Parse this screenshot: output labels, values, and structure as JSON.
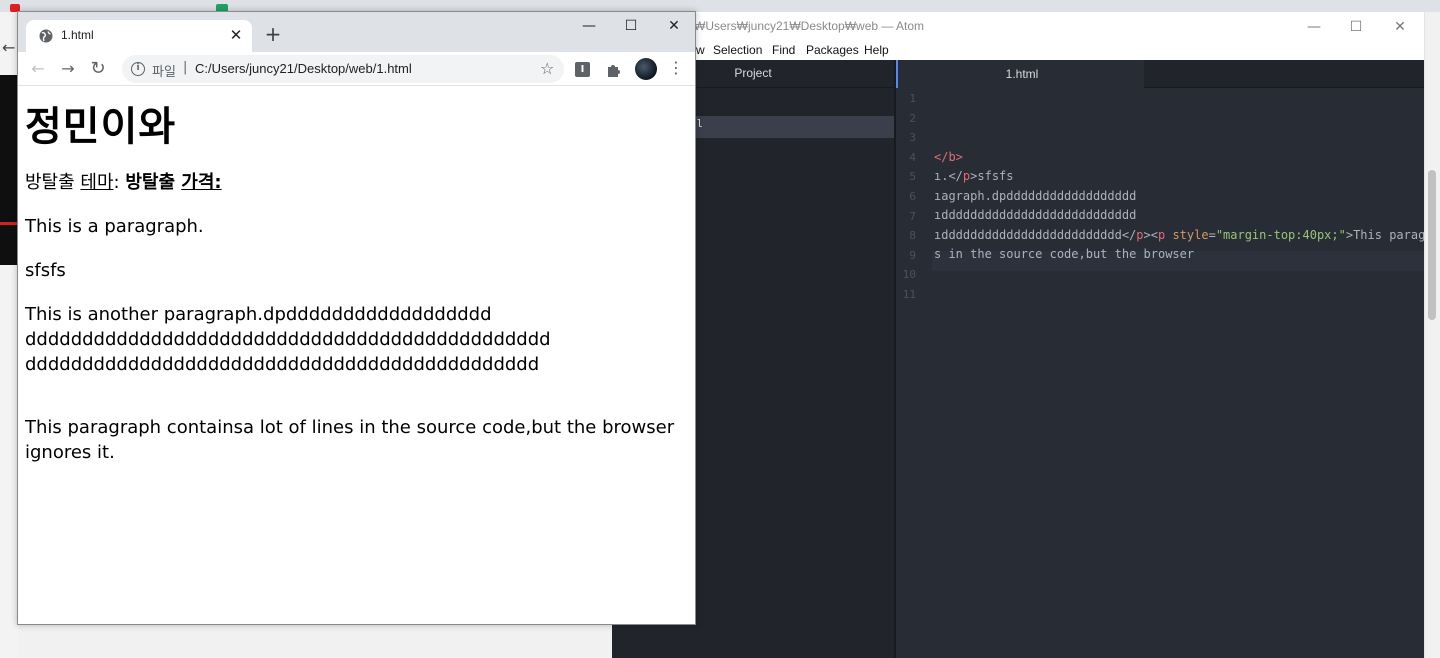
{
  "atom": {
    "title": "₩Users₩juncy21₩Desktop₩web — Atom",
    "menu": {
      "partial": "w",
      "selection": "Selection",
      "find": "Find",
      "packages": "Packages",
      "help": "Help"
    },
    "tree_view": {
      "title": "Project",
      "selected_item": "l"
    },
    "tab": "1.html",
    "line_numbers": [
      "1",
      "2",
      "3",
      "4",
      "5",
      "6",
      "7",
      "8",
      "9",
      "10",
      "11"
    ],
    "code": {
      "line4": "</b>",
      "line5_a": "ı.</",
      "line5_tag": "p",
      "line5_b": ">sfsfs",
      "line6": "ıagraph.dpdddddddddddddddddd",
      "line7": "ıddddddddddddddddddddddddddd",
      "line8_a": "ıddddddddddddddddddddddddd</",
      "line8_tag1": "p",
      "line8_b": "><",
      "line8_tag2": "p",
      "line8_attr": " style",
      "line8_eq": "=",
      "line8_str": "\"margin-top:40px;\"",
      "line8_c": ">This paragra",
      "line9": "s in the source code,but the browser"
    }
  },
  "chrome": {
    "tab_title": "1.html",
    "tab_close": "✕",
    "new_tab": "+",
    "window_controls": {
      "minimize": "—",
      "maximize": "☐",
      "close": "✕"
    },
    "toolbar": {
      "back": "←",
      "forward": "→",
      "reload": "↻",
      "scheme": "파일",
      "separator": "|",
      "url": "C:/Users/juncy21/Desktop/web/1.html",
      "star": "☆",
      "menu": "⋮",
      "ext_letter": "I"
    },
    "page": {
      "heading": "정민이와",
      "line1": {
        "t1": "방탈출 ",
        "t2": "테마",
        "t3": ": ",
        "t4": "방탈출 ",
        "t5": "가격:"
      },
      "p1": "This is a paragraph.",
      "p2": "sfsfs",
      "p3_line1": "This is another paragraph.dpdddddddddddddddddd",
      "p3_line2": "dddddddddddddddddddddddddddddddddddddddddddddd",
      "p3_line3": "ddddddddddddddddddddddddddddddddddddddddddddd",
      "p4_line1": "This paragraph containsa lot of lines in the source code,but the browser",
      "p4_line2": "ignores it."
    }
  },
  "colors": {
    "atom_bg": "#282c34",
    "atom_tree_bg": "#21252b",
    "chrome_tabstrip": "#dee1e6",
    "tag": "#e06c75",
    "attr": "#d19a66",
    "string": "#98c379"
  }
}
